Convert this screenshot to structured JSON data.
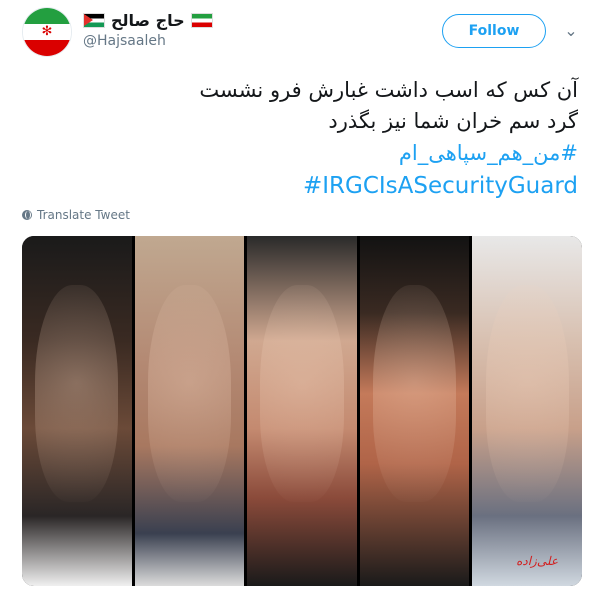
{
  "user": {
    "display_name": "حاج صالح",
    "handle": "@Hajsaaleh"
  },
  "actions": {
    "follow_label": "Follow"
  },
  "tweet": {
    "lines": [
      "آن کس که اسب داشت غبارش فرو نشست",
      "گرد سم خران شما نیز بگذرد"
    ],
    "hashtags": [
      "#من_هم_سپاهی_ام",
      "#IRGCIsASecurityGuard"
    ]
  },
  "translate_label": "Translate Tweet",
  "media": {
    "watermark": "علی‌زاده"
  },
  "colors": {
    "accent": "#1da1f2",
    "muted": "#657786",
    "text": "#14171a"
  }
}
